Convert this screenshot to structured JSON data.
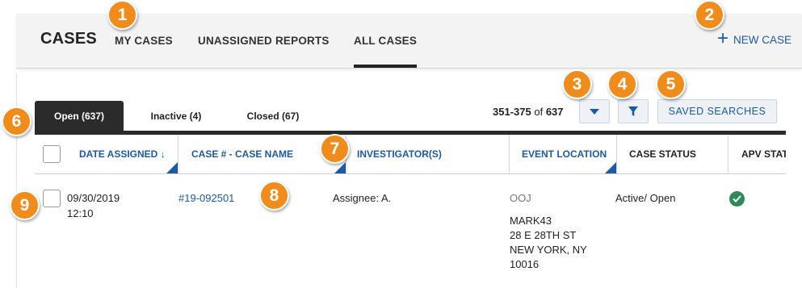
{
  "nav": {
    "brand": "CASES",
    "links": [
      "MY CASES",
      "UNASSIGNED REPORTS",
      "ALL CASES"
    ],
    "new_case": "NEW CASE"
  },
  "tabs": [
    "Open (637)",
    "Inactive (4)",
    "Closed (67)"
  ],
  "pager": {
    "range": "351-375",
    "of": "of",
    "total": "637"
  },
  "saved_searches": "SAVED SEARCHES",
  "columns": [
    "DATE ASSIGNED ↓",
    "CASE # - CASE NAME",
    "INVESTIGATOR(S)",
    "EVENT LOCATION",
    "CASE STATUS",
    "APV STAT"
  ],
  "row": {
    "date": "09/30/2019",
    "time": "12:10",
    "case": "#19-092501",
    "investigator": "Assignee: A.",
    "location_code": "OOJ",
    "location_lines": [
      "MARK43",
      "28 E 28TH ST",
      "NEW YORK, NY",
      "10016"
    ],
    "status": "Active/ Open"
  },
  "callouts": [
    "1",
    "2",
    "3",
    "4",
    "5",
    "6",
    "7",
    "8",
    "9"
  ],
  "colors": {
    "accent": "#1a5aa6",
    "callout": "#f08c1c",
    "dark_tab": "#2b2b2b",
    "ok": "#2e8b57"
  }
}
